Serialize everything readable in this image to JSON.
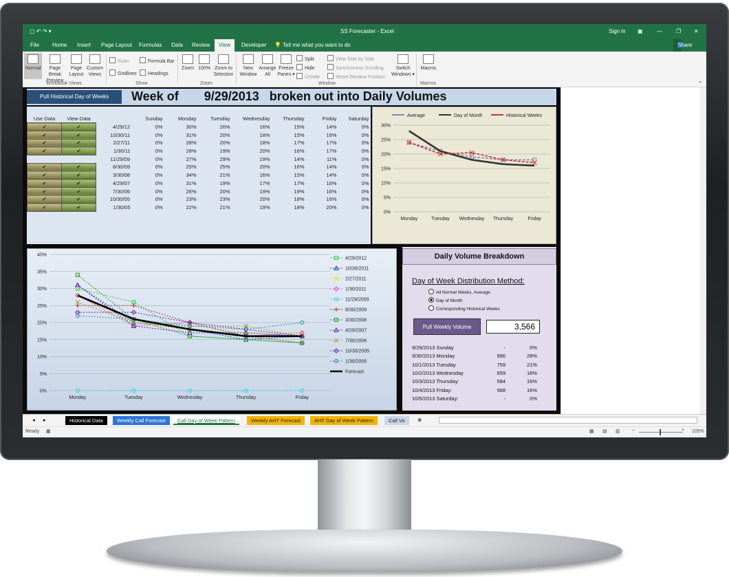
{
  "window": {
    "quick_access": "▢ ↶ ↷ ▾",
    "title": "SS Forecaster  -  Excel",
    "sign_in": "Sign in",
    "controls": [
      "▣",
      "—",
      "❐",
      "✕"
    ]
  },
  "tabs": [
    "File",
    "Home",
    "Insert",
    "Page Layout",
    "Formulas",
    "Data",
    "Review",
    "View",
    "Developer"
  ],
  "tell_me": "Tell me what you want to do",
  "share": "Share",
  "ribbon": {
    "views": [
      "Normal",
      "Page Break Preview",
      "Page Layout",
      "Custom Views"
    ],
    "group_views": "Workbook Views",
    "show": [
      "Ruler",
      "Formula Bar",
      "Gridlines",
      "Headings"
    ],
    "group_show": "Show",
    "zoom": [
      "Zoom",
      "100%",
      "Zoom to Selection"
    ],
    "group_zoom": "Zoom",
    "window": [
      "New Window",
      "Arrange All",
      "Freeze Panes ▾",
      "Split",
      "Hide",
      "Unhide",
      "View Side by Side",
      "Synchronous Scrolling",
      "Reset Window Position",
      "Switch Windows ▾"
    ],
    "group_window": "Window",
    "macros": "Macros",
    "group_macros": "Macros"
  },
  "dashboard": {
    "pull_button": "Pull Historical Day of Weeks",
    "title_prefix": "Week of",
    "title_date": "9/29/2013",
    "title_suffix": "broken out into Daily Volumes",
    "col_use": "Use Data",
    "col_view": "View Data",
    "check_mark": "✔",
    "days": [
      "Sunday",
      "Monday",
      "Tuesday",
      "Wednesday",
      "Thursday",
      "Friday",
      "Saturday"
    ],
    "rows": [
      {
        "date": "4/29/12",
        "use": true,
        "view": true,
        "vals": [
          "0%",
          "30%",
          "26%",
          "16%",
          "15%",
          "14%",
          "0%"
        ]
      },
      {
        "date": "10/30/11",
        "use": true,
        "view": true,
        "vals": [
          "0%",
          "31%",
          "20%",
          "18%",
          "15%",
          "16%",
          "0%"
        ]
      },
      {
        "date": "2/27/11",
        "use": true,
        "view": true,
        "vals": [
          "0%",
          "28%",
          "20%",
          "18%",
          "17%",
          "17%",
          "0%"
        ]
      },
      {
        "date": "1/30/11",
        "use": true,
        "view": true,
        "vals": [
          "0%",
          "28%",
          "19%",
          "20%",
          "16%",
          "17%",
          "0%"
        ]
      },
      {
        "date": "11/29/09",
        "use": false,
        "view": false,
        "vals": [
          "0%",
          "27%",
          "29%",
          "19%",
          "14%",
          "11%",
          "0%"
        ]
      },
      {
        "date": "8/30/09",
        "use": true,
        "view": true,
        "vals": [
          "0%",
          "25%",
          "25%",
          "20%",
          "16%",
          "14%",
          "0%"
        ]
      },
      {
        "date": "3/30/08",
        "use": true,
        "view": true,
        "vals": [
          "0%",
          "34%",
          "21%",
          "16%",
          "15%",
          "14%",
          "0%"
        ]
      },
      {
        "date": "4/29/07",
        "use": true,
        "view": true,
        "vals": [
          "0%",
          "31%",
          "19%",
          "17%",
          "17%",
          "16%",
          "0%"
        ]
      },
      {
        "date": "7/30/06",
        "use": true,
        "view": true,
        "vals": [
          "0%",
          "26%",
          "20%",
          "19%",
          "19%",
          "16%",
          "0%"
        ]
      },
      {
        "date": "10/30/05",
        "use": true,
        "view": true,
        "vals": [
          "0%",
          "23%",
          "23%",
          "20%",
          "18%",
          "16%",
          "0%"
        ]
      },
      {
        "date": "1/30/05",
        "use": true,
        "view": true,
        "vals": [
          "0%",
          "22%",
          "21%",
          "19%",
          "18%",
          "20%",
          "0%"
        ]
      }
    ]
  },
  "breakdown": {
    "heading": "Daily Volume Breakdown",
    "subheading": "Day of Week Distribution Method:",
    "options": [
      "All Normal Weeks, Average",
      "Day of Month",
      "Corresponding Historical Weeks"
    ],
    "selected": 1,
    "button": "Pull Weekly Volume",
    "weekly_volume": "3,566",
    "lines": [
      {
        "label": "9/29/2013 Sunday",
        "vol": "-",
        "pct": "0%"
      },
      {
        "label": "9/30/2013 Monday",
        "vol": "996",
        "pct": "28%"
      },
      {
        "label": "10/1/2013 Tuesday",
        "vol": "759",
        "pct": "21%"
      },
      {
        "label": "10/2/2013 Wednesday",
        "vol": "659",
        "pct": "18%"
      },
      {
        "label": "10/3/2013 Thursday:",
        "vol": "584",
        "pct": "16%"
      },
      {
        "label": "10/4/2013 Friday:",
        "vol": "568",
        "pct": "16%"
      },
      {
        "label": "10/5/2013 Saturday:",
        "vol": "-",
        "pct": "0%"
      }
    ]
  },
  "sheet_tabs": [
    {
      "label": "Historical Data",
      "color": "#000000",
      "text": "#ffffff"
    },
    {
      "label": "Weekly Call Forecast",
      "color": "#2e75d6",
      "text": "#ffffff"
    },
    {
      "label": "Call Day of Week Pattern",
      "color": "#ffffff",
      "text": "#217346"
    },
    {
      "label": "Weekly AHT Forecast",
      "color": "#f4b400",
      "text": "#222222"
    },
    {
      "label": "AHT Day of Week Pattern",
      "color": "#f4b400",
      "text": "#222222"
    },
    {
      "label": "Call Vo",
      "color": "#c9d7ea",
      "text": "#222222"
    }
  ],
  "status": {
    "ready": "Ready",
    "zoom": "105%"
  },
  "chart_data": [
    {
      "type": "line",
      "categories": [
        "Monday",
        "Tuesday",
        "Wednesday",
        "Thursday",
        "Friday"
      ],
      "ylim": [
        0,
        30
      ],
      "yticks": [
        "0%",
        "5%",
        "10%",
        "15%",
        "20%",
        "25%",
        "30%"
      ],
      "legend": "top",
      "series": [
        {
          "name": "Average",
          "values": [
            24,
            21,
            19,
            18,
            18
          ],
          "color": "#8f7fb4"
        },
        {
          "name": "Day of Month",
          "values": [
            28,
            21,
            18,
            16.5,
            16
          ],
          "color": "#333333"
        },
        {
          "name": "Historical Weeks",
          "values": [
            24,
            20,
            20.5,
            18,
            17
          ],
          "color": "#c0392b"
        }
      ]
    },
    {
      "type": "line",
      "categories": [
        "Monday",
        "Tuesday",
        "Wednesday",
        "Thursday",
        "Friday"
      ],
      "ylim": [
        0,
        40
      ],
      "yticks": [
        "0%",
        "5%",
        "10%",
        "15%",
        "20%",
        "25%",
        "30%",
        "35%",
        "40%"
      ],
      "legend": "right",
      "series": [
        {
          "name": "4/29/2012",
          "values": [
            30,
            26,
            16,
            15,
            14
          ],
          "color": "#2ecc40"
        },
        {
          "name": "10/30/2011",
          "values": [
            31,
            20,
            18,
            15,
            16
          ],
          "color": "#1f3fbf"
        },
        {
          "name": "2/27/2011",
          "values": [
            28,
            20,
            18,
            17,
            17
          ],
          "color": "#e6e600"
        },
        {
          "name": "1/30/2011",
          "values": [
            28,
            19,
            20,
            16,
            17
          ],
          "color": "#e040e0"
        },
        {
          "name": "11/29/2009",
          "values": [
            0,
            0,
            0,
            0,
            0
          ],
          "color": "#29d3e0"
        },
        {
          "name": "8/30/2009",
          "values": [
            25,
            25,
            20,
            16,
            14
          ],
          "color": "#a3332b"
        },
        {
          "name": "3/30/2008",
          "values": [
            34,
            21,
            16,
            15,
            14
          ],
          "color": "#2f8f2f"
        },
        {
          "name": "4/29/2007",
          "values": [
            31,
            19,
            17,
            17,
            16
          ],
          "color": "#5a2d9c"
        },
        {
          "name": "7/30/2006",
          "values": [
            26,
            20,
            19,
            19,
            16
          ],
          "color": "#9c9c2e"
        },
        {
          "name": "10/30/2005",
          "values": [
            23,
            23,
            20,
            18,
            16
          ],
          "color": "#6a1b9a"
        },
        {
          "name": "1/30/2005",
          "values": [
            22,
            21,
            19,
            18,
            20
          ],
          "color": "#2a8aa8"
        },
        {
          "name": "Forecast",
          "values": [
            28,
            21,
            18,
            16,
            16
          ],
          "color": "#000000"
        }
      ]
    }
  ]
}
